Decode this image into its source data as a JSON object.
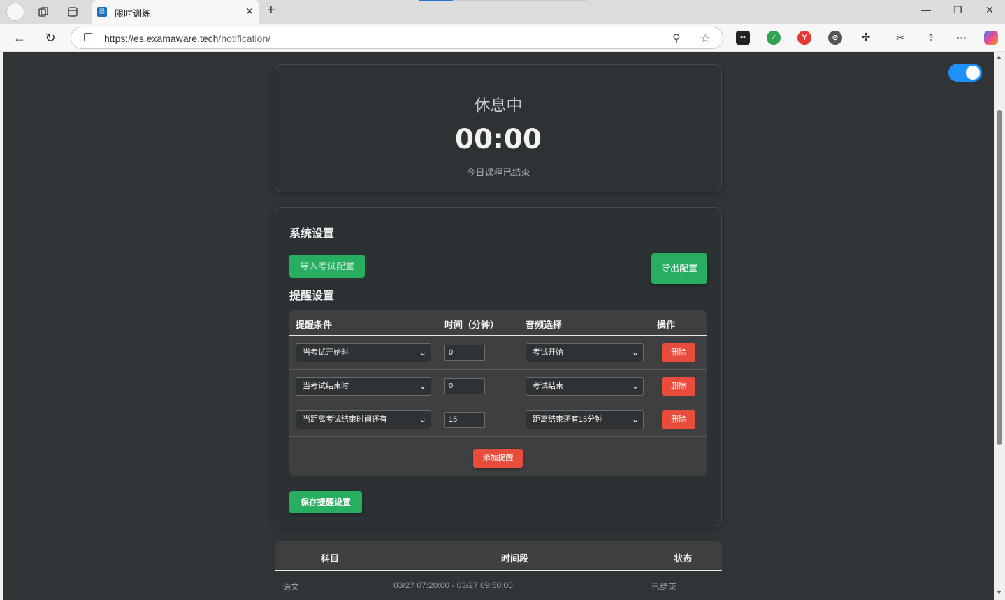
{
  "browser": {
    "tab_title": "限时训练",
    "url_host": "https://es.examaware.tech",
    "url_path": "/notification/"
  },
  "status": {
    "state": "休息中",
    "timer": "00:00",
    "subtitle": "今日课程已结束"
  },
  "settings": {
    "system_title": "系统设置",
    "import_label": "导入考试配置",
    "export_label": "导出配置",
    "reminder_title": "提醒设置",
    "columns": [
      "提醒条件",
      "时间（分钟）",
      "音频选择",
      "操作"
    ],
    "rows": [
      {
        "condition": "当考试开始时",
        "minutes": "0",
        "audio": "考试开始",
        "action": "删除"
      },
      {
        "condition": "当考试结束时",
        "minutes": "0",
        "audio": "考试结束",
        "action": "删除"
      },
      {
        "condition": "当距离考试结束时间还有",
        "minutes": "15",
        "audio": "距离结束还有15分钟",
        "action": "删除"
      }
    ],
    "add_label": "添加提醒",
    "save_label": "保存提醒设置"
  },
  "schedule": {
    "columns": [
      "科目",
      "时间段",
      "状态"
    ],
    "rows": [
      {
        "subject": "语文",
        "period": "03/27 07:20:00 - 03/27 09:50:00",
        "status": "已结束"
      }
    ]
  },
  "theme": {
    "accent_green": "#27ae60",
    "danger_red": "#e74c3c",
    "toggle_blue": "#1e90ff",
    "page_bg": "#2f3437"
  }
}
